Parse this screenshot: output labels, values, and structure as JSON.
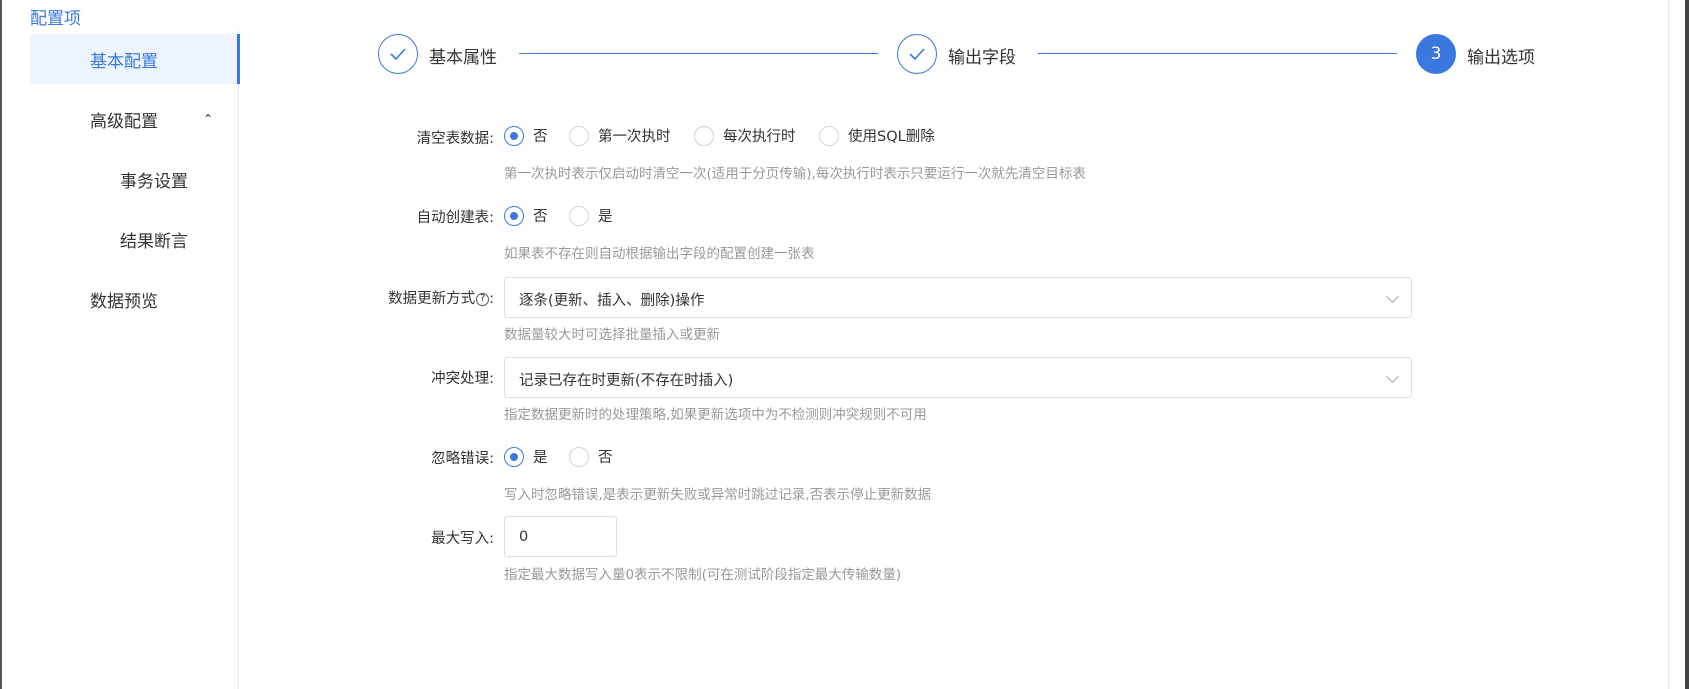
{
  "header": {
    "title": "配置项"
  },
  "sidebar": {
    "items": [
      {
        "label": "基本配置"
      },
      {
        "label": "高级配置"
      },
      {
        "label": "事务设置"
      },
      {
        "label": "结果断言"
      },
      {
        "label": "数据预览"
      }
    ],
    "active_color": "#3a78e0"
  },
  "steps": [
    {
      "label": "基本属性",
      "icon": "check-icon"
    },
    {
      "label": "输出字段",
      "icon": "check-icon"
    },
    {
      "label": "输出选项",
      "number": "3"
    }
  ],
  "form": {
    "clear_table": {
      "label": "清空表数据:",
      "options": [
        "否",
        "第一次执时",
        "每次执行时",
        "使用SQL删除"
      ],
      "selected": "否",
      "hint": "第一次执时表示仅启动时清空一次(适用于分页传输),每次执行时表示只要运行一次就先清空目标表"
    },
    "auto_create": {
      "label": "自动创建表:",
      "options": [
        "否",
        "是"
      ],
      "selected": "否",
      "hint": "如果表不存在则自动根据输出字段的配置创建一张表"
    },
    "update_mode": {
      "label": "数据更新方式",
      "help_icon": "question-circle-icon",
      "value": "逐条(更新、插入、删除)操作",
      "hint": "数据量较大时可选择批量插入或更新"
    },
    "conflict": {
      "label": "冲突处理:",
      "value": "记录已存在时更新(不存在时插入)",
      "hint": "指定数据更新时的处理策略,如果更新选项中为不检测则冲突规则不可用"
    },
    "ignore_errors": {
      "label": "忽略错误:",
      "options": [
        "是",
        "否"
      ],
      "selected": "是",
      "hint": "写入时忽略错误,是表示更新失败或异常时跳过记录,否表示停止更新数据"
    },
    "max_write": {
      "label": "最大写入:",
      "value": "0",
      "hint": "指定最大数据写入量0表示不限制(可在测试阶段指定最大传输数量)"
    }
  }
}
